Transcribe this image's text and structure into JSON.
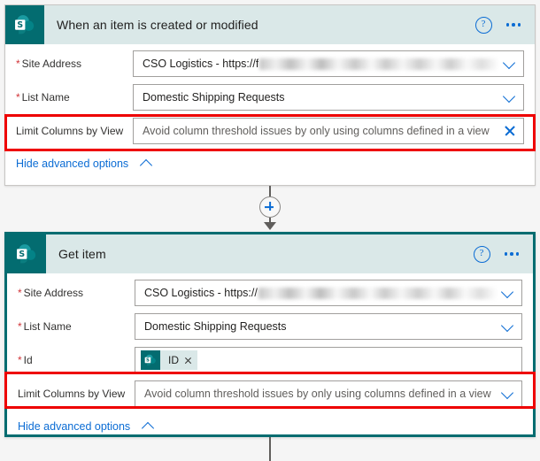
{
  "colors": {
    "brand_teal": "#036c70",
    "header_band": "#dae8e8",
    "link_blue": "#0b6cd4",
    "required_red": "#d13438",
    "highlight_red": "#ee0000",
    "page_background": "#f5f5f5"
  },
  "cards": [
    {
      "icon": "sharepoint-icon",
      "title": "When an item is created or modified",
      "help_icon": "help-circle-icon",
      "more_icon": "ellipsis-icon",
      "selected": false,
      "fields": [
        {
          "label": "Site Address",
          "required": true,
          "value": "CSO Logistics - https://f",
          "redacted": true,
          "trailing_icon": "chevron-down-icon",
          "highlighted": false
        },
        {
          "label": "List Name",
          "required": true,
          "value": "Domestic Shipping Requests",
          "redacted": false,
          "trailing_icon": "chevron-down-icon",
          "highlighted": false
        },
        {
          "label": "Limit Columns by View",
          "required": false,
          "value": "Avoid column threshold issues by only using columns defined in a view",
          "is_placeholder": true,
          "redacted": false,
          "trailing_icon": "close-icon",
          "highlighted": true
        }
      ],
      "advanced_link": {
        "label": "Hide advanced options",
        "icon": "chevron-up-icon"
      }
    },
    {
      "icon": "sharepoint-icon",
      "title": "Get item",
      "help_icon": "help-circle-icon",
      "more_icon": "ellipsis-icon",
      "selected": true,
      "fields": [
        {
          "label": "Site Address",
          "required": true,
          "value": "CSO Logistics - https://",
          "redacted": true,
          "trailing_icon": "chevron-down-icon",
          "highlighted": false
        },
        {
          "label": "List Name",
          "required": true,
          "value": "Domestic Shipping Requests",
          "redacted": false,
          "trailing_icon": "chevron-down-icon",
          "highlighted": false
        },
        {
          "label": "Id",
          "required": true,
          "token": {
            "icon": "sharepoint-icon",
            "label": "ID",
            "remove_icon": "close-icon"
          },
          "trailing_icon": null,
          "highlighted": false
        },
        {
          "label": "Limit Columns by View",
          "required": false,
          "value": "Avoid column threshold issues by only using columns defined in a view",
          "is_placeholder": true,
          "redacted": false,
          "trailing_icon": "chevron-down-icon",
          "highlighted": true
        }
      ],
      "advanced_link": {
        "label": "Hide advanced options",
        "icon": "chevron-up-icon"
      }
    }
  ],
  "connector": {
    "add_icon": "plus-circle-icon",
    "arrow_icon": "arrow-down-icon"
  }
}
